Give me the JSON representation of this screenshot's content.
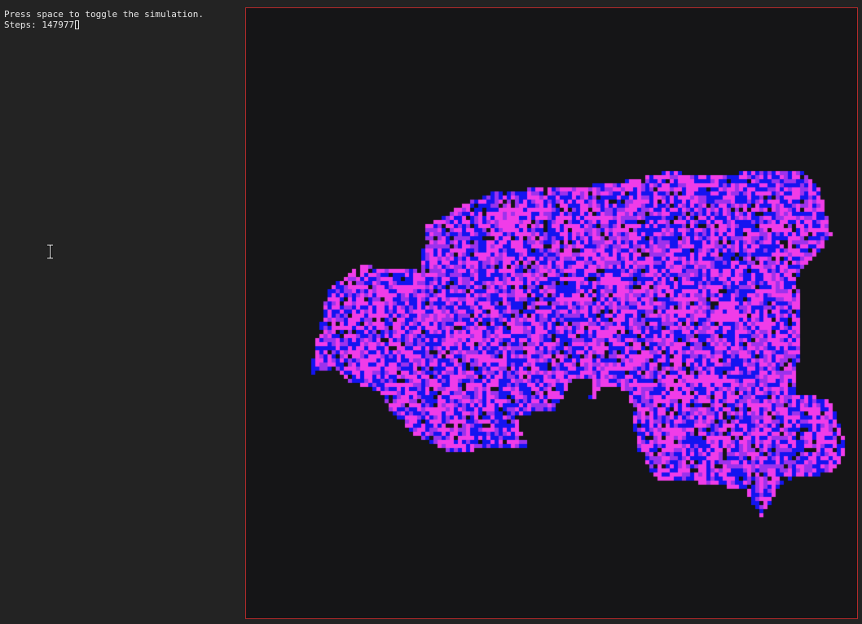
{
  "info": {
    "instruction": "Press space to toggle the simulation.",
    "steps_label": "Steps:",
    "steps_value": "147977"
  },
  "simulation": {
    "running": false,
    "colors": {
      "background": "#151517",
      "frame_border": "#b22a2a",
      "cell_magenta": "#f03ce8",
      "cell_blue": "#1414f0",
      "cell_purple": "#9c32ec"
    }
  }
}
